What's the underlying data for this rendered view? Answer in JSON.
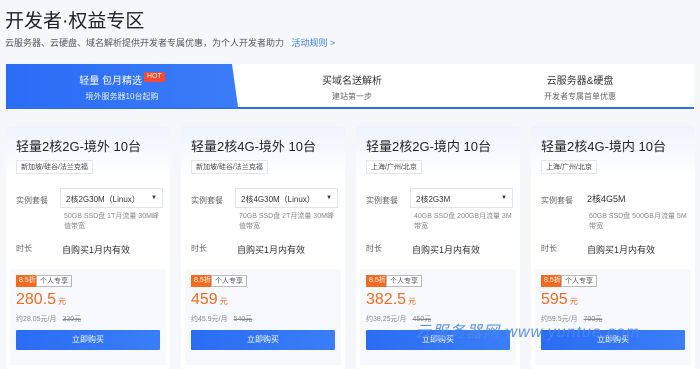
{
  "header": {
    "title": "开发者·权益专区",
    "subtitle": "云服务器、云硬盘、域名解析提供开发者专属优惠，为个人开发者助力",
    "rules_link": "活动规则 >"
  },
  "tabs": [
    {
      "label": "轻量 包月精选",
      "badge": "HOT",
      "sub": "境外服务器10台起购"
    },
    {
      "label": "买域名送解析",
      "sub": "建站第一步"
    },
    {
      "label": "云服务器&硬盘",
      "sub": "开发者专属首单优惠"
    }
  ],
  "labels": {
    "plan": "实例套餐",
    "duration": "时长",
    "discount": "8.5折",
    "personal": "个人专享",
    "buy": "立即购买",
    "currency": "元"
  },
  "cards": [
    {
      "title": "轻量2核2G-境外 10台",
      "region": "新加坡/硅谷/法兰克福",
      "plan": "2核2G30M（Linux）",
      "spec": "50GB SSD盘 1T月流量 30M峰值带宽",
      "duration": "自购买1月内有效",
      "price": "280.5",
      "monthly": "约28.05元/月",
      "original": "330元"
    },
    {
      "title": "轻量2核4G-境外 10台",
      "region": "新加坡/硅谷/法兰克福",
      "plan": "2核4G30M（Linux）",
      "spec": "70GB SSD盘 2T月流量 30M峰值带宽",
      "duration": "自购买1月内有效",
      "price": "459",
      "monthly": "约45.9元/月",
      "original": "540元"
    },
    {
      "title": "轻量2核2G-境内 10台",
      "region": "上海/广州/北京",
      "plan": "2核2G3M",
      "spec": "40GB SSD盘 200GB月流量 3M带宽",
      "duration": "自购买1月内有效",
      "price": "382.5",
      "monthly": "约38.25元/月",
      "original": "450元"
    },
    {
      "title": "轻量2核4G-境内 10台",
      "region": "上海/广州/北京",
      "plan": "2核4G5M",
      "spec": "60GB SSD盘 500GB月流量 5M带宽",
      "duration": "自购买1月内有效",
      "price": "595",
      "monthly": "约59.5元/月",
      "original": "700元"
    }
  ],
  "watermark": "云服务器网 www.yuntue.com"
}
